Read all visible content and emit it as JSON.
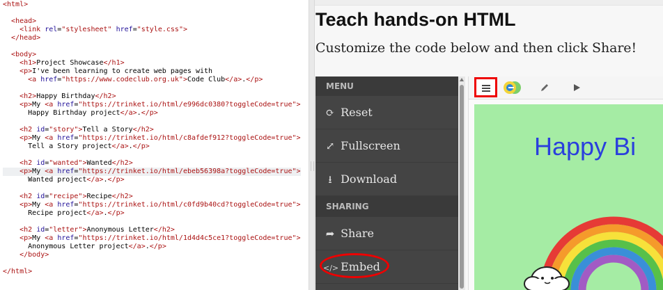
{
  "editor": {
    "lines": [
      "<html>",
      "",
      "  <head>",
      "    <link rel=\"stylesheet\" href=\"style.css\">",
      "  </head>",
      "",
      "  <body>",
      "    <h1>Project Showcase</h1>",
      "    <p>I've been learning to create web pages with",
      "      <a href=\"https://www.codeclub.org.uk\">Code Club</a>.</p>",
      "",
      "    <h2>Happy Birthday</h2>",
      "    <p>My <a href=\"https://trinket.io/html/e996dc0380?toggleCode=true\">",
      "      Happy Birthday project</a>.</p>",
      "",
      "    <h2 id=\"story\">Tell a Story</h2>",
      "    <p>My <a href=\"https://trinket.io/html/c8afdef912?toggleCode=true\">",
      "      Tell a Story project</a>.</p>",
      "",
      "    <h2 id=\"wanted\">Wanted</h2>",
      "    <p>My <a href=\"https://trinket.io/html/ebeb56398a?toggleCode=true\">",
      "      Wanted project</a>.</p>",
      "",
      "    <h2 id=\"recipe\">Recipe</h2>",
      "    <p>My <a href=\"https://trinket.io/html/c0fd9b40cd?toggleCode=true\">",
      "      Recipe project</a>.</p>",
      "",
      "    <h2 id=\"letter\">Anonymous Letter</h2>",
      "    <p>My <a href=\"https://trinket.io/html/1d4d4c5ce1?toggleCode=true\">",
      "      Anonymous Letter project</a>.</p>",
      "    </body>",
      "",
      "</html>"
    ],
    "highlighted_line": 20
  },
  "page": {
    "title": "Teach hands-on HTML",
    "subtitle": "Customize the code below and then click Share!"
  },
  "menu": {
    "header": "MENU",
    "items": [
      {
        "label": "Reset",
        "icon": "refresh-icon",
        "glyph": "⟳"
      },
      {
        "label": "Fullscreen",
        "icon": "expand-icon",
        "glyph": "⤢"
      },
      {
        "label": "Download",
        "icon": "download-icon",
        "glyph": "⭳"
      }
    ],
    "sharing_header": "SHARING",
    "sharing_items": [
      {
        "label": "Share",
        "icon": "share-icon",
        "glyph": "➦"
      },
      {
        "label": "Embed",
        "icon": "code-icon",
        "glyph": "</>"
      }
    ]
  },
  "preview": {
    "heading": "Happy Bi"
  },
  "colors": {
    "tag": "#a11",
    "attr": "#219",
    "highlight": "#e00",
    "menu_bg": "#444",
    "preview_bg": "#a5eca4",
    "preview_title": "#2a3fdd"
  }
}
